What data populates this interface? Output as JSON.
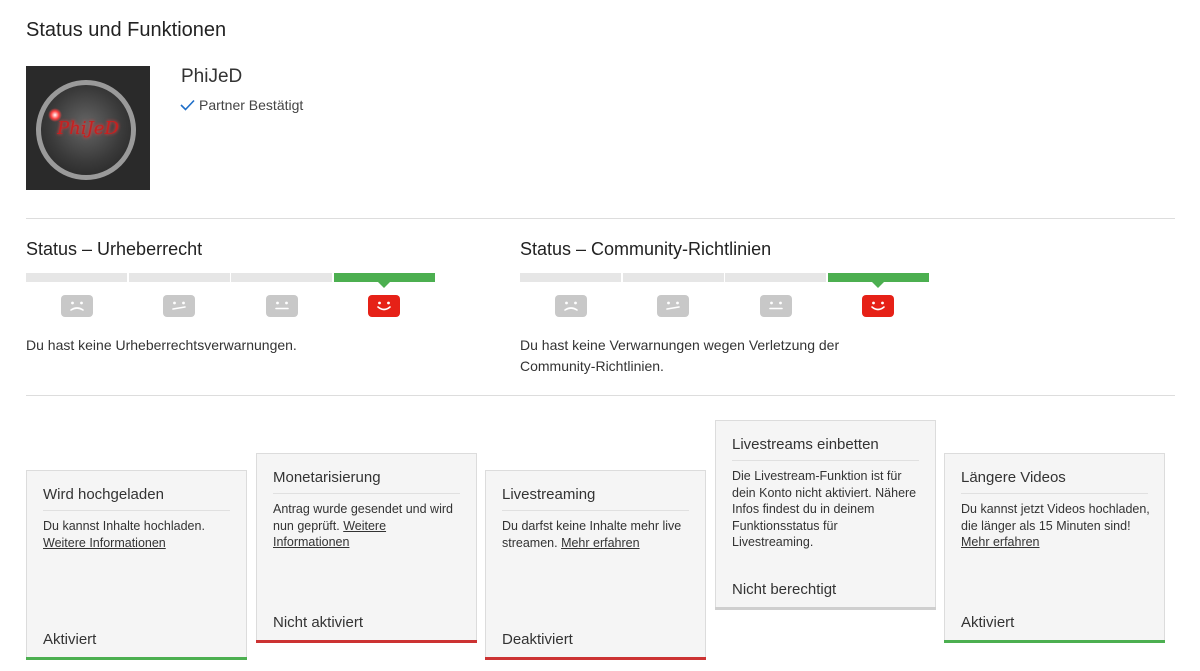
{
  "page": {
    "title": "Status und Funktionen"
  },
  "channel": {
    "name": "PhiJeD",
    "avatar_text": "PhiJeD",
    "partner_label": "Partner Bestätigt"
  },
  "copyright": {
    "title": "Status – Urheberrecht",
    "level": 4,
    "levels": 4,
    "text": "Du hast keine Urheberrechtsverwarnungen."
  },
  "community": {
    "title": "Status – Community-Richtlinien",
    "level": 4,
    "levels": 4,
    "text": "Du hast keine Verwarnungen wegen Verletzung der Community-Richtlinien."
  },
  "colors": {
    "green": "#4caf50",
    "red": "#cc3333",
    "grey_bar": "#e6e6e6",
    "grey_face": "#c8c8c8",
    "active_face": "#e62117"
  },
  "cards": [
    {
      "title": "Wird hochgeladen",
      "desc": "Du kannst Inhalte hochladen.",
      "link": "Weitere Informationen",
      "state": "Aktiviert",
      "state_color": "green"
    },
    {
      "title": "Monetarisierung",
      "desc": "Antrag wurde gesendet und wird nun geprüft.",
      "link": "Weitere Informationen",
      "state": "Nicht aktiviert",
      "state_color": "red"
    },
    {
      "title": "Livestreaming",
      "desc": "Du darfst keine Inhalte mehr live streamen.",
      "link": "Mehr erfahren",
      "state": "Deaktiviert",
      "state_color": "red"
    },
    {
      "title": "Livestreams einbetten",
      "desc": "Die Livestream-Funktion ist für dein Konto nicht aktiviert. Nähere Infos findest du in deinem Funktionsstatus für Livestreaming.",
      "link": "",
      "state": "Nicht berechtigt",
      "state_color": "grey"
    },
    {
      "title": "Längere Videos",
      "desc": "Du kannst jetzt Videos hochladen, die länger als 15 Minuten sind!",
      "link": "Mehr erfahren",
      "state": "Aktiviert",
      "state_color": "green"
    }
  ]
}
